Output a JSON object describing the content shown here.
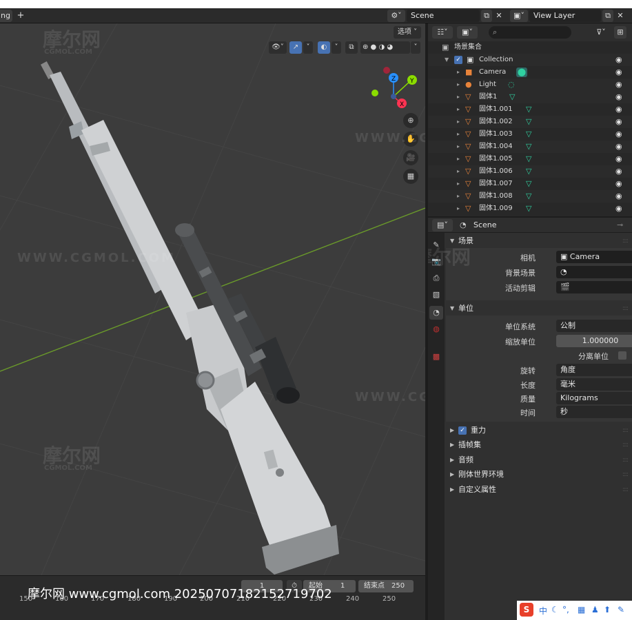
{
  "header": {
    "tab_cut_label": "ng",
    "tab_plus": "+",
    "scene_name": "Scene",
    "view_layer_name": "View Layer"
  },
  "viewport": {
    "options_label": "选项",
    "watermark_logo": "摩尔网",
    "watermark_domain": "CGMOL.COM",
    "watermark_url": "WWW.CGMOL.COM",
    "gizmo_axes": [
      "Z",
      "Y",
      "X"
    ],
    "nav_icons": [
      "zoom-icon",
      "pan-hand-icon",
      "camera-view-icon",
      "perspective-grid-icon"
    ]
  },
  "timeline": {
    "current_frame": "1",
    "start_label": "起始",
    "start_value": "1",
    "end_label": "结束点",
    "end_value": "250",
    "frame_numbers": [
      "150",
      "160",
      "170",
      "180",
      "190",
      "200",
      "210",
      "220",
      "230",
      "240",
      "250"
    ],
    "footer_watermark": "摩尔网 www.cgmol.com 20250707182152719702"
  },
  "outliner": {
    "search_placeholder": "",
    "root_label": "场景集合",
    "rows": [
      {
        "label": "Collection",
        "kind": "collection"
      },
      {
        "label": "Camera",
        "kind": "camera"
      },
      {
        "label": "Light",
        "kind": "light"
      },
      {
        "label": "固体1",
        "kind": "mesh"
      },
      {
        "label": "固体1.001",
        "kind": "mesh"
      },
      {
        "label": "固体1.002",
        "kind": "mesh"
      },
      {
        "label": "固体1.003",
        "kind": "mesh"
      },
      {
        "label": "固体1.004",
        "kind": "mesh"
      },
      {
        "label": "固体1.005",
        "kind": "mesh"
      },
      {
        "label": "固体1.006",
        "kind": "mesh"
      },
      {
        "label": "固体1.007",
        "kind": "mesh"
      },
      {
        "label": "固体1.008",
        "kind": "mesh"
      },
      {
        "label": "固体1.009",
        "kind": "mesh"
      }
    ]
  },
  "properties": {
    "context_name": "Scene",
    "scene_section": {
      "title": "场景",
      "camera_label": "相机",
      "camera_value": "Camera",
      "background_label": "背景场景",
      "active_clip_label": "活动剪辑"
    },
    "units_section": {
      "title": "单位",
      "unit_system_label": "单位系统",
      "unit_system_value": "公制",
      "unit_scale_label": "缩放单位",
      "unit_scale_value": "1.000000",
      "separate_units_label": "分离单位",
      "rotation_label": "旋转",
      "rotation_value": "角度",
      "length_label": "长度",
      "length_value": "毫米",
      "mass_label": "质量",
      "mass_value": "Kilograms",
      "time_label": "时间",
      "time_value": "秒"
    },
    "collapsed_sections": [
      "重力",
      "插帧集",
      "音频",
      "刚体世界环境",
      "自定义属性"
    ]
  },
  "colors": {
    "accent": "#4772b3",
    "viewport_bg": "#3c3c3c",
    "panel_bg": "#303030",
    "mesh_icon": "#e8833a",
    "vertex_icon": "#2fd1a0",
    "axis_x": "#ff3352",
    "axis_y": "#8bdc00",
    "axis_z": "#2890ff"
  }
}
